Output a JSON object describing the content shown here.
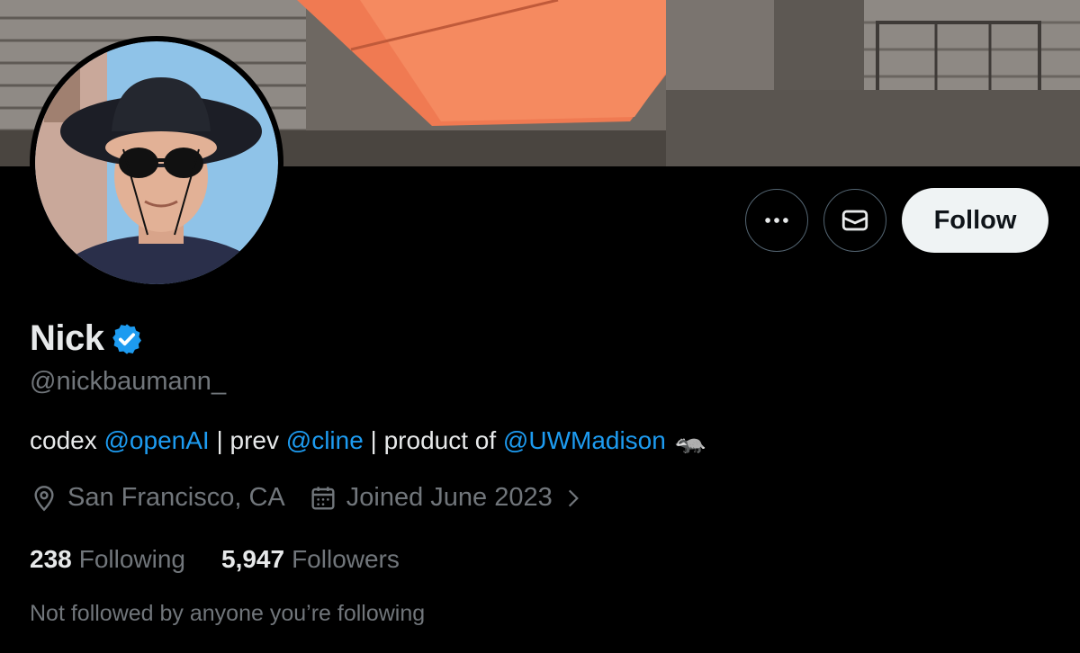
{
  "banner": {
    "description_icon": "banner-photo"
  },
  "avatar": {
    "icon": "avatar-photo"
  },
  "actions": {
    "more_icon": "more-icon",
    "message_icon": "envelope-icon",
    "follow_label": "Follow"
  },
  "profile": {
    "name": "Nick",
    "verified_icon": "verified-badge-icon",
    "handle": "@nickbaumann_",
    "bio": {
      "text1": "codex ",
      "mention1": "@openAI",
      "text2": " | prev ",
      "mention2": "@cline",
      "text3": " | product of ",
      "mention3": "@UWMadison",
      "emoji": "🦡"
    },
    "location": "San Francisco, CA",
    "joined": "Joined June 2023",
    "following_count": "238",
    "following_label": "Following",
    "followers_count": "5,947",
    "followers_label": "Followers",
    "followed_by_note": "Not followed by anyone you’re following"
  },
  "colors": {
    "accent": "#1d9bf0",
    "secondary_text": "#71767b",
    "primary_text": "#e7e9ea",
    "follow_button_bg": "#eff3f4"
  }
}
